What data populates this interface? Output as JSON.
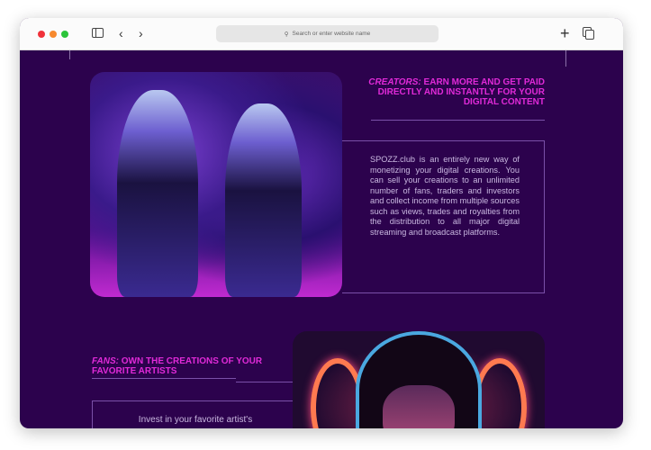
{
  "browser": {
    "url_placeholder": "Search or enter website name"
  },
  "section1": {
    "title_em": "CREATORS:",
    "title_rest": "EARN MORE AND GET PAID DIRECTLY AND INSTANTLY FOR YOUR DIGITAL CONTENT",
    "body": "SPOZZ.club is an entirely new way of monetizing your digital creations. You can sell your creations to an unlimited number of fans, traders and investors and collect income from multiple sources such as views, trades and royalties from the distribution to all major digital streaming and broadcast platforms."
  },
  "section2": {
    "title_em": "FANS:",
    "title_rest": "OWN THE CREATIONS OF YOUR FAVORITE ARTISTS",
    "body": "Invest in your favorite artist's"
  }
}
